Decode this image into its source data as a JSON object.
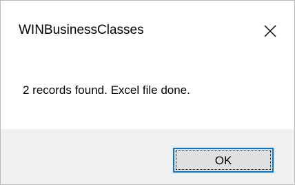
{
  "dialog": {
    "title": "WINBusinessClasses",
    "message": "2 records found.  Excel file done.",
    "ok_label": "OK",
    "close_icon": "close-icon"
  },
  "colors": {
    "accent": "#0078d7",
    "footer_background": "#f0f0f0",
    "button_background": "#e1e1e1"
  }
}
